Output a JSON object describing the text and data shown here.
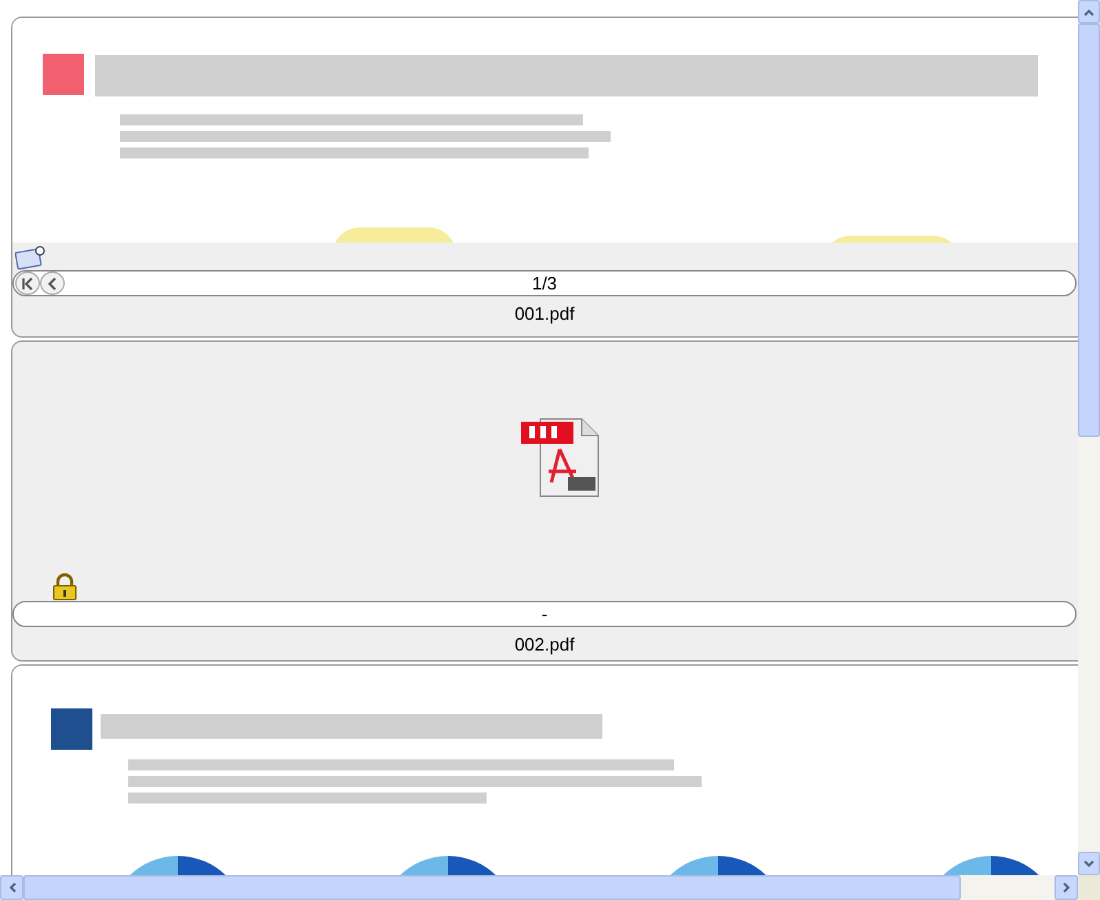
{
  "files": [
    {
      "name": "001.pdf",
      "kind": "thumbnail",
      "color": "#f0606e",
      "page": "1/3",
      "locked": false,
      "has_text_layer": true,
      "show_nav": true
    },
    {
      "name": "002.pdf",
      "kind": "pdf-icon",
      "page": "-",
      "locked": true,
      "has_text_layer": false,
      "show_nav": false
    },
    {
      "kind": "thumbnail",
      "color": "#1f4f8f"
    }
  ]
}
